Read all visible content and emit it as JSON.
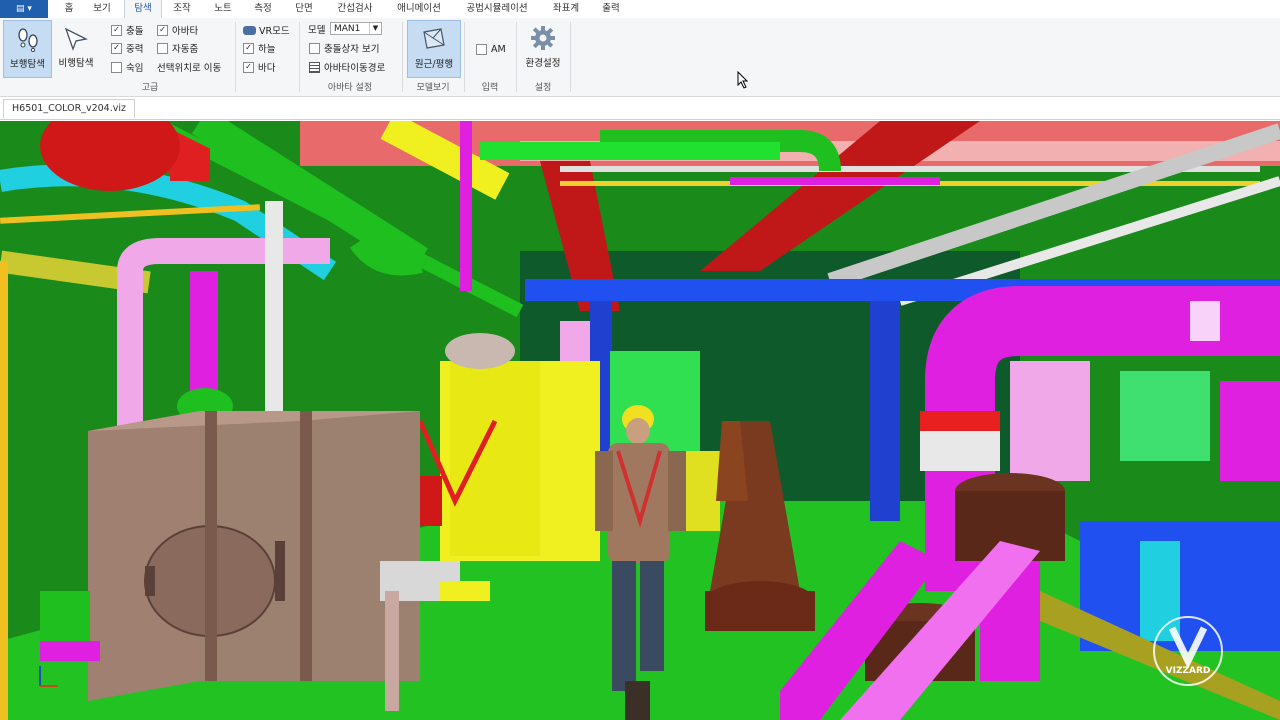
{
  "menubar": {
    "app_menu_icon": "app-menu-icon",
    "tabs": [
      "홈",
      "보기",
      "탐색",
      "조작",
      "노트",
      "측정",
      "단면",
      "간섭검사",
      "애니메이션",
      "공법시뮬레이션",
      "좌표계",
      "출력"
    ],
    "active_tab": "탐색"
  },
  "ribbon": {
    "buttons": {
      "walk": "보행탐색",
      "fly": "비행탐색",
      "perspective": "원근/평행",
      "settings": "환경설정"
    },
    "checks": {
      "collision": "충돌",
      "gravity": "중력",
      "crouch": "숙임",
      "avatar": "아바타",
      "auto_step": "자동줌",
      "move_to_selection": "선택위치로 이동",
      "vr_mode": "VR모드",
      "sky": "하늘",
      "floor": "바다",
      "show_collision_box": "충돌상자 보기",
      "avatar_path": "아바타이동경로",
      "am": "AM"
    },
    "model_label": "모델",
    "model_value": "MAN1",
    "groups": {
      "advanced": "고급",
      "avatar_settings": "아바타 설정",
      "model_view": "모델보기",
      "input": "입력",
      "settings": "설정"
    }
  },
  "document": {
    "tab_name": "H6501_COLOR_v204.viz"
  },
  "viewport": {
    "watermark": "VIZZARD",
    "colors": {
      "pipe_green": "#1fbf1f",
      "pipe_magenta": "#e020e0",
      "pipe_cyan": "#20d0e0",
      "pipe_yellow": "#f0f020",
      "beam_red": "#d01818",
      "beam_blue": "#2050f0",
      "floor_green": "#22c222",
      "machine_brown": "#6b3420",
      "tank_tan": "#9c8070"
    }
  }
}
